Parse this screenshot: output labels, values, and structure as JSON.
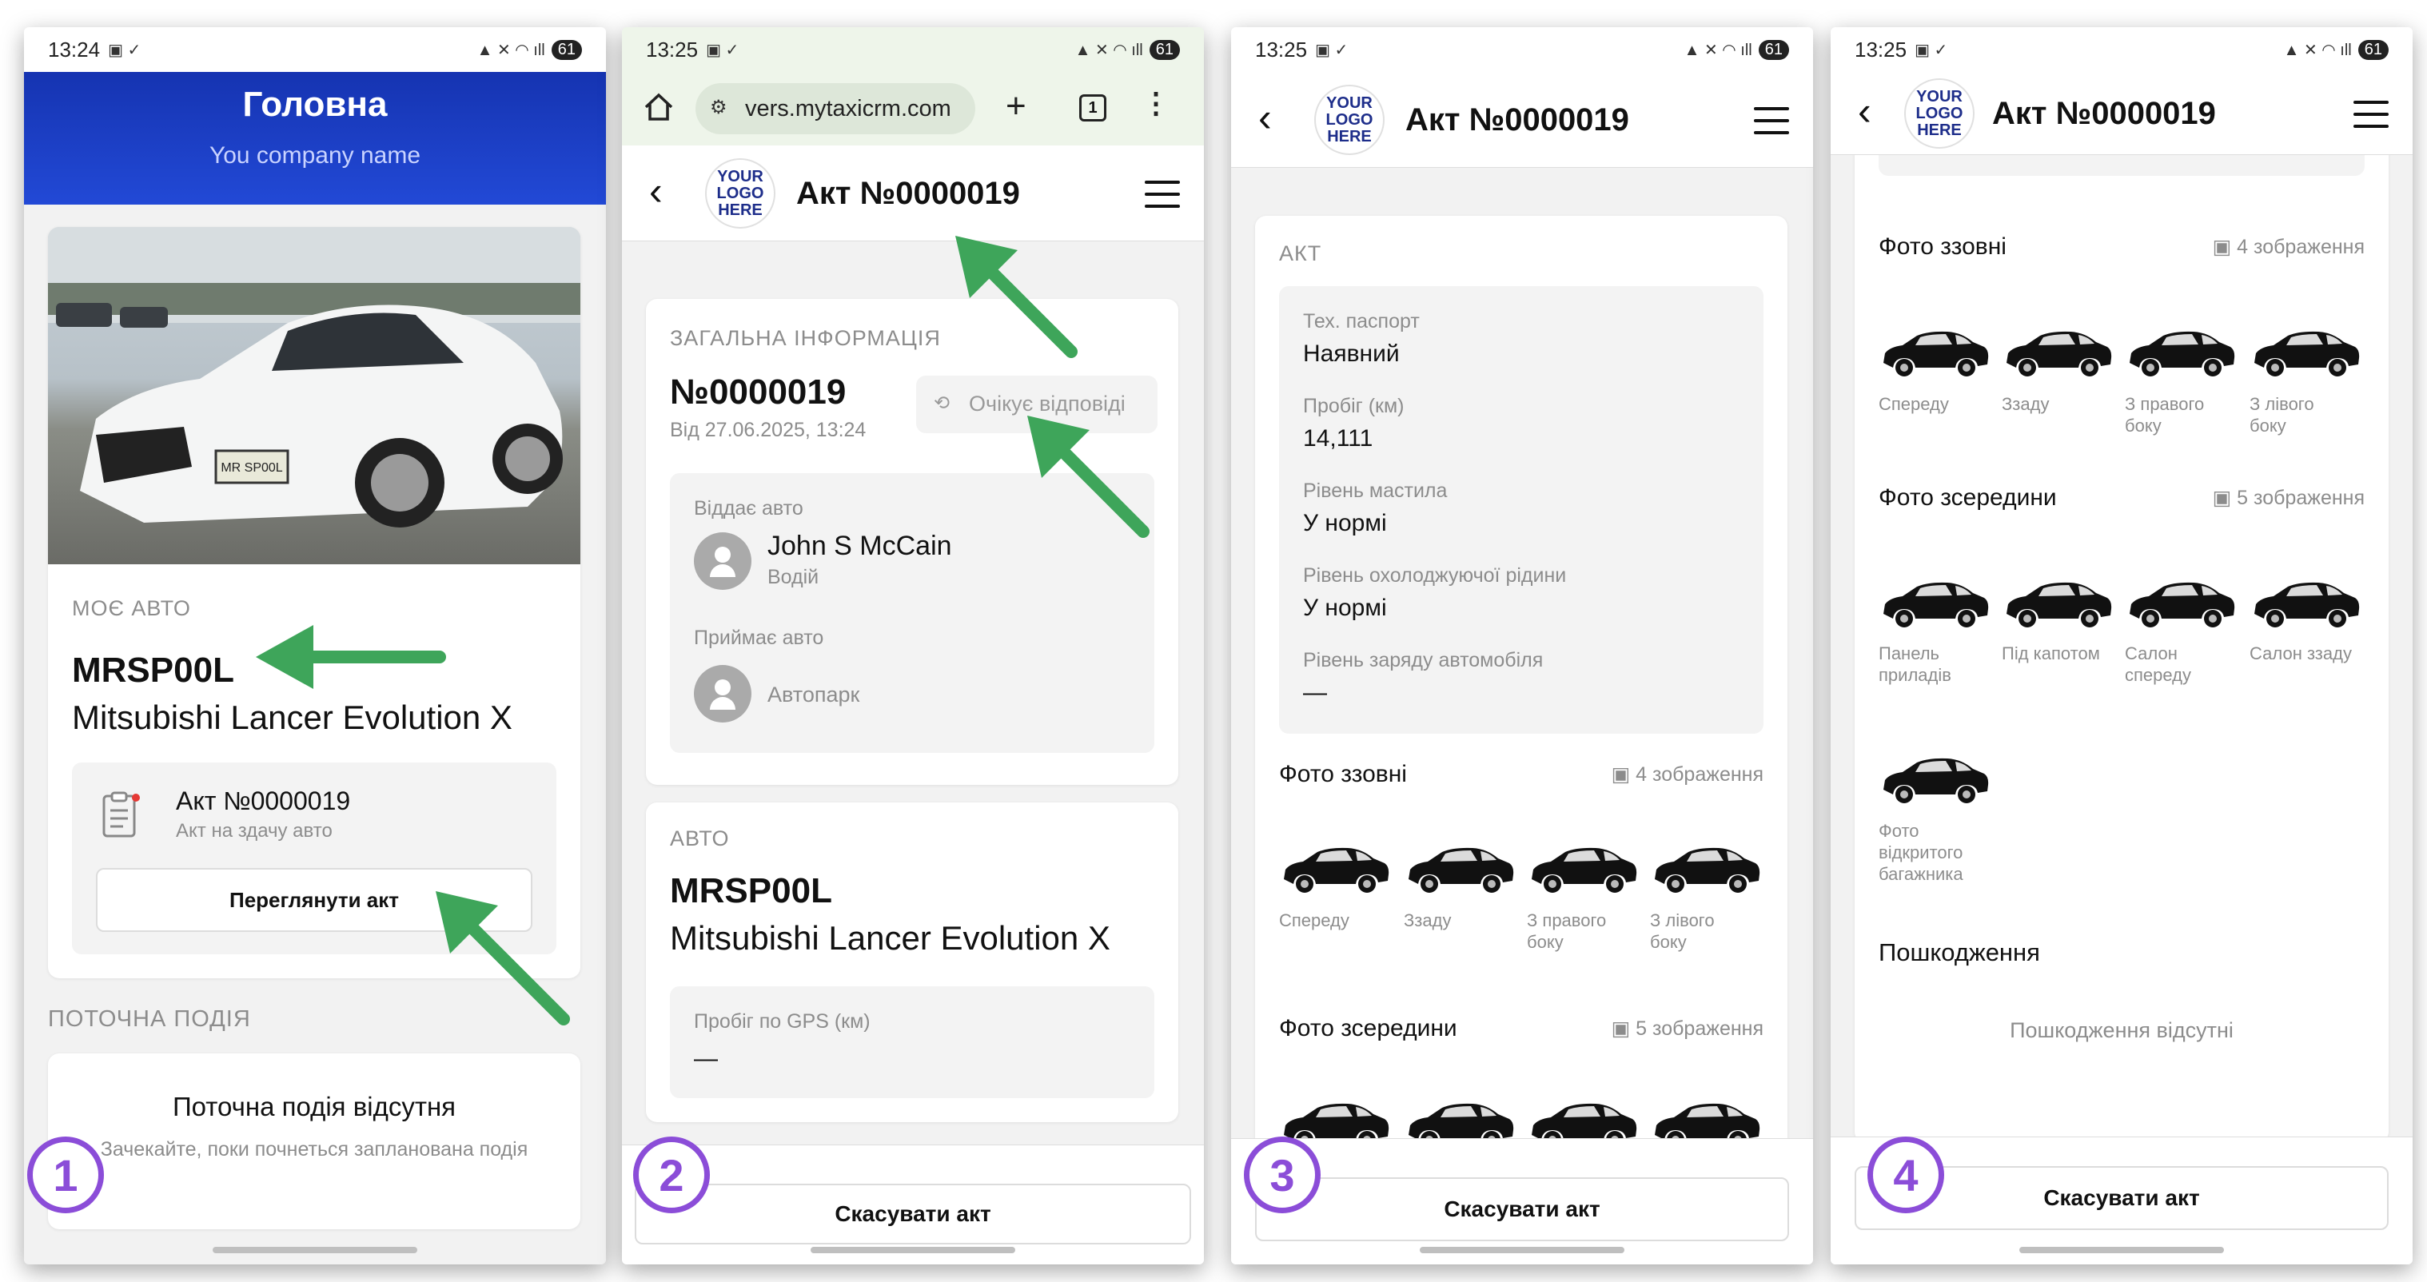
{
  "screens": [
    {
      "step": "1",
      "time": "13:24",
      "battery": "61",
      "home_title": "Головна",
      "company": "You company name",
      "my_car": {
        "caption": "МОЄ АВТО",
        "plate": "MRSP00L",
        "model": "Mitsubishi Lancer Evolution X",
        "act": {
          "title": "Акт №0000019",
          "subtitle": "Акт на здачу авто",
          "button": "Переглянути акт"
        }
      },
      "current_event": {
        "caption": "ПОТОЧНА ПОДІЯ",
        "title": "Поточна подія відсутня",
        "subtitle": "Зачекайте, поки почнеться запланована подія"
      }
    },
    {
      "step": "2",
      "time": "13:25",
      "battery": "61",
      "url": "vers.mytaxicrm.com",
      "tabs_count": "1",
      "logo": "YOUR LOGO HERE",
      "title": "Акт №0000019",
      "general": {
        "caption": "ЗАГАЛЬНА ІНФОРМАЦІЯ",
        "number": "№0000019",
        "date": "Від 27.06.2025, 13:24",
        "status": "Очікує відповіді",
        "giver_label": "Віддає авто",
        "giver_name": "John S McCain",
        "giver_role": "Водій",
        "receiver_label": "Приймає авто",
        "receiver_name": "Автопарк"
      },
      "car": {
        "caption": "АВТО",
        "plate": "MRSP00L",
        "model": "Mitsubishi Lancer Evolution X",
        "gps_label": "Пробіг по GPS (км)",
        "gps_value": "—"
      },
      "cancel": "Скасувати акт"
    },
    {
      "step": "3",
      "time": "13:25",
      "battery": "61",
      "logo": "YOUR LOGO HERE",
      "title": "Акт №0000019",
      "act": {
        "caption": "АКТ",
        "fields": [
          {
            "label": "Тех. паспорт",
            "value": "Наявний"
          },
          {
            "label": "Пробіг (км)",
            "value": "14,111"
          },
          {
            "label": "Рівень мастила",
            "value": "У нормі"
          },
          {
            "label": "Рівень охолоджуючої рідини",
            "value": "У нормі"
          },
          {
            "label": "Рівень заряду автомобіля",
            "value": "—"
          }
        ]
      },
      "outside": {
        "title": "Фото ззовні",
        "count": "4 зображення",
        "photos": [
          "Спереду",
          "Ззаду",
          "З правого боку",
          "З лівого боку"
        ]
      },
      "inside": {
        "title": "Фото зсередини",
        "count": "5 зображення"
      },
      "cancel": "Скасувати акт"
    },
    {
      "step": "4",
      "time": "13:25",
      "battery": "61",
      "logo": "YOUR LOGO HERE",
      "title": "Акт №0000019",
      "outside": {
        "title": "Фото ззовні",
        "count": "4 зображення",
        "photos": [
          "Спереду",
          "Ззаду",
          "З правого боку",
          "З лівого боку"
        ]
      },
      "inside": {
        "title": "Фото зсередини",
        "count": "5 зображення",
        "photos": [
          "Панель приладів",
          "Під капотом",
          "Салон спереду",
          "Салон ззаду",
          "Фото відкритого багажника"
        ]
      },
      "damage": {
        "title": "Пошкодження",
        "empty": "Пошкодження відсутні"
      },
      "cancel": "Скасувати акт"
    }
  ],
  "colors": {
    "header_blue": "#1a3fc4",
    "arrow_green": "#3ea55a",
    "step_purple": "#8b4dd8",
    "status_gray": "#8c8c8c"
  }
}
